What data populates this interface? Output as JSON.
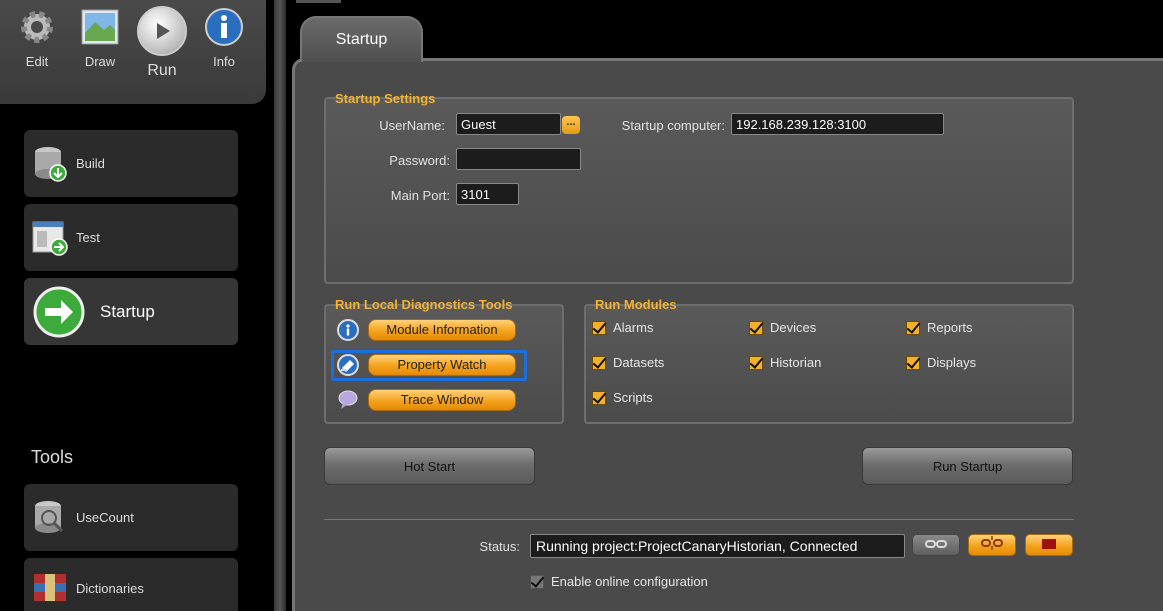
{
  "modes": [
    {
      "label": "Edit",
      "icon": "gear-icon"
    },
    {
      "label": "Draw",
      "icon": "picture-icon"
    },
    {
      "label": "Run",
      "icon": "play-icon"
    },
    {
      "label": "Info",
      "icon": "info-icon"
    }
  ],
  "nav": {
    "build": "Build",
    "test": "Test",
    "startup": "Startup",
    "tools_header": "Tools",
    "usecount": "UseCount",
    "dictionaries": "Dictionaries"
  },
  "tab": {
    "label": "Startup"
  },
  "startup_settings": {
    "title": "Startup Settings",
    "username_label": "UserName:",
    "username_value": "Guest",
    "browse_label": "...",
    "password_label": "Password:",
    "password_value": "",
    "main_port_label": "Main Port:",
    "main_port_value": "3101",
    "computer_label": "Startup computer:",
    "computer_value": "192.168.239.128:3100"
  },
  "diagnostics": {
    "title": "Run Local Diagnostics Tools",
    "module_information": "Module Information",
    "property_watch": "Property Watch",
    "trace_window": "Trace Window"
  },
  "run_modules": {
    "title": "Run Modules",
    "items": [
      {
        "label": "Alarms",
        "checked": true
      },
      {
        "label": "Devices",
        "checked": true
      },
      {
        "label": "Reports",
        "checked": true
      },
      {
        "label": "Datasets",
        "checked": true
      },
      {
        "label": "Historian",
        "checked": true
      },
      {
        "label": "Displays",
        "checked": true
      },
      {
        "label": "Scripts",
        "checked": true
      }
    ]
  },
  "actions": {
    "hot_start": "Hot Start",
    "run_startup": "Run Startup"
  },
  "status": {
    "label": "Status:",
    "value": "Running project:ProjectCanaryHistorian, Connected",
    "online_config_label": "Enable online configuration"
  },
  "colors": {
    "accent_orange": "#f5a21c",
    "title_gold": "#f2b233",
    "highlight_blue": "#1a6fdc"
  }
}
